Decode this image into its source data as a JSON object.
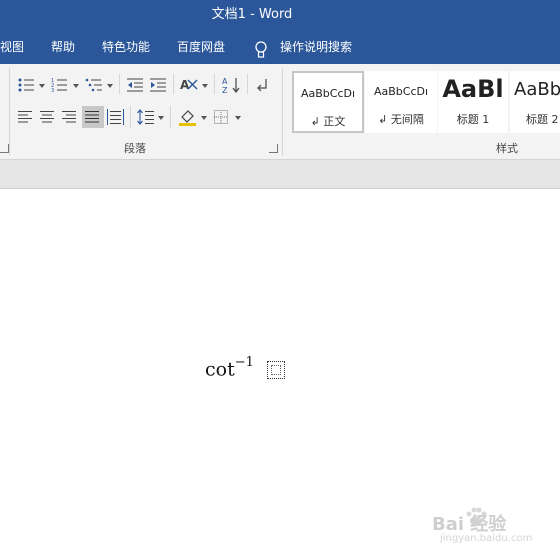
{
  "window": {
    "title": "文档1  -  Word"
  },
  "tabs": [
    {
      "label": "视图"
    },
    {
      "label": "帮助"
    },
    {
      "label": "特色功能"
    },
    {
      "label": "百度网盘"
    },
    {
      "label": "操作说明搜索"
    }
  ],
  "ribbon": {
    "paragraph_label": "段落",
    "styles_label": "样式",
    "styles": [
      {
        "sample": "AaBbCcDı",
        "name": "↲ 正文"
      },
      {
        "sample": "AaBbCcDı",
        "name": "↲ 无间隔"
      },
      {
        "sample": "AaBl",
        "name": "标题 1"
      },
      {
        "sample": "AaBb",
        "name": "标题 2"
      }
    ]
  },
  "document": {
    "equation_base": "cot",
    "equation_sup": "−1"
  },
  "watermark": {
    "brand": "Bai 经验",
    "url": "jingyan.baidu.com"
  },
  "colors": {
    "ribbon_blue": "#2b579a",
    "ribbon_bg": "#f3f3f3"
  }
}
